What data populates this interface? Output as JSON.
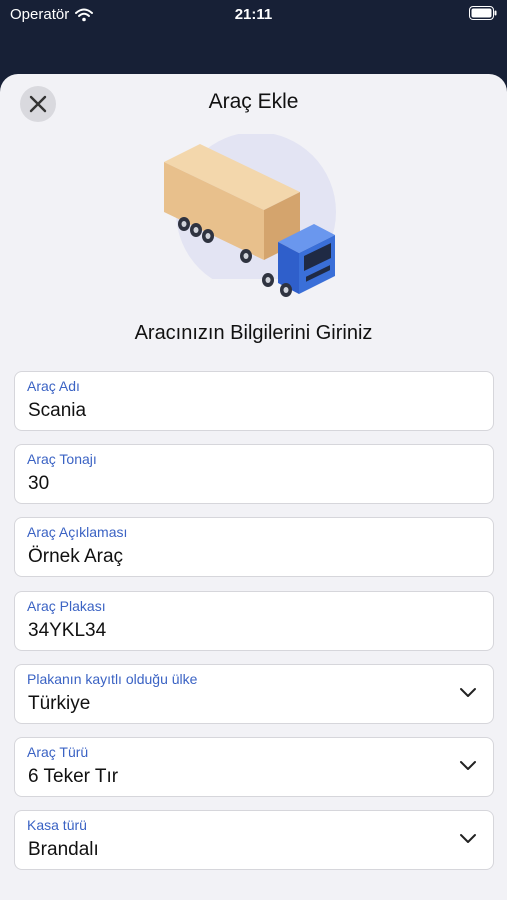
{
  "status_bar": {
    "carrier": "Operatör",
    "time": "21:11"
  },
  "sheet": {
    "title": "Araç Ekle",
    "subtitle": "Aracınızın Bilgilerini Giriniz"
  },
  "form": {
    "fields": [
      {
        "label": "Araç Adı",
        "value": "Scania"
      },
      {
        "label": "Araç Tonajı",
        "value": "30"
      },
      {
        "label": "Araç Açıklaması",
        "value": "Örnek Araç"
      },
      {
        "label": "Araç Plakası",
        "value": "34YKL34"
      },
      {
        "label": "Plakanın kayıtlı olduğu ülke",
        "value": "Türkiye"
      },
      {
        "label": "Araç Türü",
        "value": "6 Teker Tır"
      },
      {
        "label": "Kasa türü",
        "value": "Brandalı"
      }
    ]
  },
  "icons": {
    "close": "close-icon",
    "wifi": "wifi-icon",
    "battery": "battery-icon",
    "chevron": "chevron-down-icon",
    "illustration": "truck-illustration"
  },
  "colors": {
    "header_bg": "#172036",
    "sheet_bg": "#f2f2f6",
    "label": "#3b63c4",
    "truck_cab": "#3a6fd8",
    "truck_cargo": "#e8c08c"
  }
}
